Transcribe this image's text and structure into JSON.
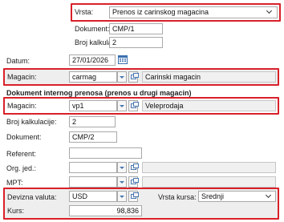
{
  "vrsta": {
    "label": "Vrsta:",
    "value": "Prenos iz carinskog magacina"
  },
  "dokument1": {
    "label": "Dokument:",
    "value": "CMP/1"
  },
  "kalkulacija1": {
    "label": "Broj kalkulacije",
    "value": "2"
  },
  "datum": {
    "label": "Datum:",
    "value": "27/01/2026"
  },
  "magacin1": {
    "label": "Magacin:",
    "code": "carmag",
    "name": "Carinski magacin"
  },
  "section_title": "Dokument internog prenosa (prenos u drugi magacin)",
  "magacin2": {
    "label": "Magacin:",
    "code": "vp1",
    "name": "Veleprodaja"
  },
  "kalkulacija2": {
    "label": "Broj kalkulacije:",
    "value": "2"
  },
  "dokument2": {
    "label": "Dokument:",
    "value": "CMP/2"
  },
  "referent": {
    "label": "Referent:",
    "value": ""
  },
  "org_jed": {
    "label": "Org. jed.:",
    "value": ""
  },
  "mpt": {
    "label": "MPT:",
    "value": ""
  },
  "devizna": {
    "label": "Devizna valuta:",
    "value": "USD"
  },
  "vrsta_kursa": {
    "label": "Vrsta kursa:",
    "value": "Srednji"
  },
  "kurs": {
    "label": "Kurs:",
    "value": "98,836"
  },
  "colors": {
    "highlight": "#d9202a",
    "accent": "#4a78b0"
  }
}
